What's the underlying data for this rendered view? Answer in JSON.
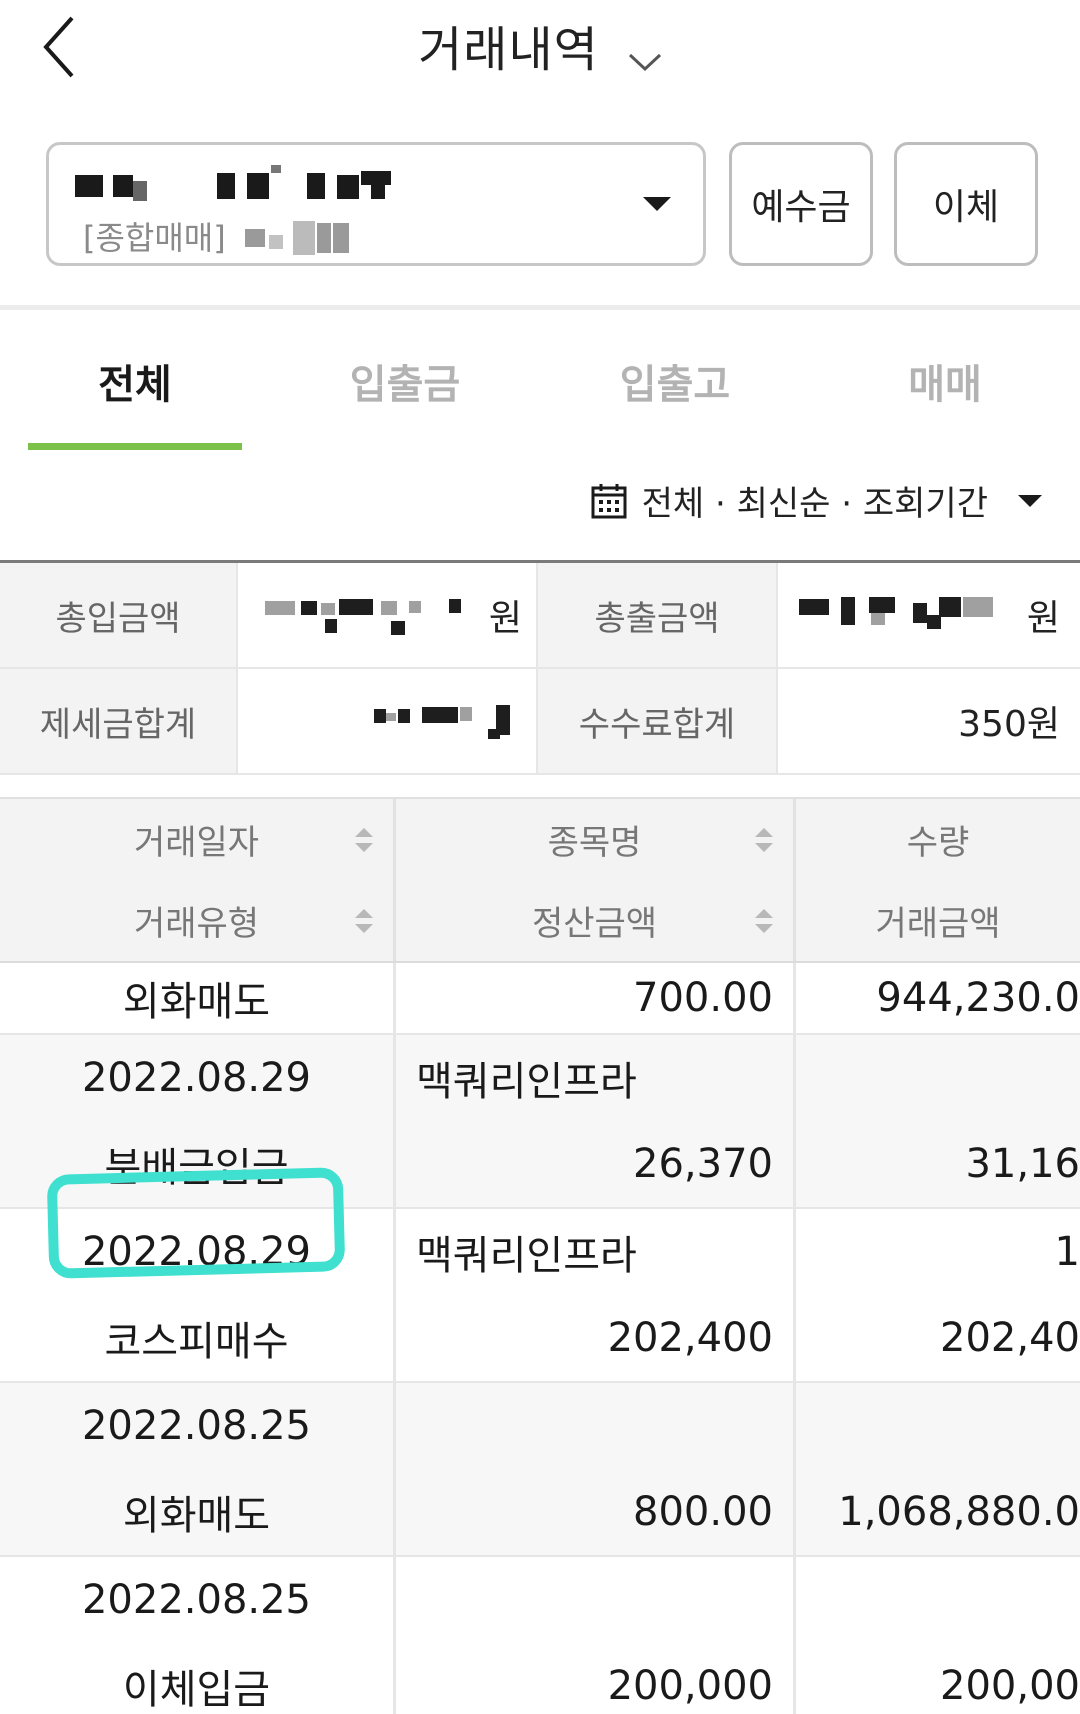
{
  "header": {
    "title": "거래내역"
  },
  "account": {
    "type_label": "[종합매매]"
  },
  "buttons": {
    "deposit": "예수금",
    "transfer": "이체"
  },
  "tabs": [
    {
      "label": "전체",
      "active": true
    },
    {
      "label": "입출금",
      "active": false
    },
    {
      "label": "입출고",
      "active": false
    },
    {
      "label": "매매",
      "active": false
    }
  ],
  "filter": {
    "text": "전체 · 최신순 · 조회기간"
  },
  "summary": {
    "total_in_label": "총입금액",
    "total_in_unit": "원",
    "total_out_label": "총출금액",
    "total_out_unit": "원",
    "tax_label": "제세금합계",
    "fee_label": "수수료합계",
    "fee_value": "350원"
  },
  "table": {
    "headers": {
      "date": "거래일자",
      "type": "거래유형",
      "name": "종목명",
      "settle": "정산금액",
      "qty": "수량",
      "amount": "거래금액"
    },
    "rows": [
      {
        "date": "",
        "type": "외화매도",
        "name": "",
        "settle": "700.00",
        "qty": "",
        "amount": "944,230.0"
      },
      {
        "date": "2022.08.29",
        "type": "분배금입금",
        "name": "맥쿼리인프라",
        "settle": "26,370",
        "qty": "",
        "amount": "31,16"
      },
      {
        "date": "2022.08.29",
        "type": "코스피매수",
        "name": "맥쿼리인프라",
        "settle": "202,400",
        "qty": "1",
        "amount": "202,40"
      },
      {
        "date": "2022.08.25",
        "type": "외화매도",
        "name": "",
        "settle": "800.00",
        "qty": "",
        "amount": "1,068,880.0"
      },
      {
        "date": "2022.08.25",
        "type": "이체입금",
        "name": "",
        "settle": "200,000",
        "qty": "",
        "amount": "200,00"
      }
    ]
  },
  "colors": {
    "accent": "#7cc14a",
    "highlight": "#3fe0cf"
  }
}
